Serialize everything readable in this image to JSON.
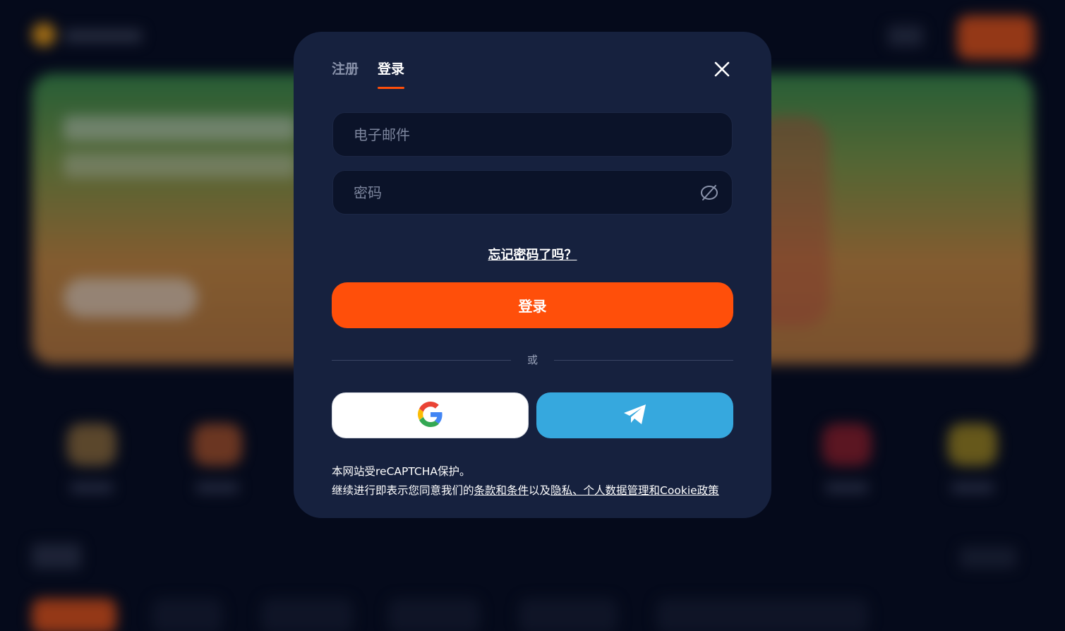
{
  "modal": {
    "tabs": [
      {
        "label": "注册",
        "active": false
      },
      {
        "label": "登录",
        "active": true
      }
    ],
    "email": {
      "placeholder": "电子邮件",
      "value": ""
    },
    "password": {
      "placeholder": "密码",
      "value": ""
    },
    "forgot_label": "忘记密码了吗？",
    "submit_label": "登录",
    "divider_label": "或",
    "social": {
      "google_icon": "google-icon",
      "telegram_icon": "telegram-icon"
    },
    "legal": {
      "line1": "本网站受reCAPTCHA保护。",
      "line2_prefix": "继续进行即表示您同意我们的",
      "terms_link": "条款和条件",
      "middle": "以及",
      "privacy_link": "隐私、个人数据管理和Cookie政策"
    }
  },
  "colors": {
    "modal_bg": "#16213e",
    "accent": "#ff4f0a",
    "telegram": "#36a8de",
    "field_bg": "#0b1329"
  }
}
